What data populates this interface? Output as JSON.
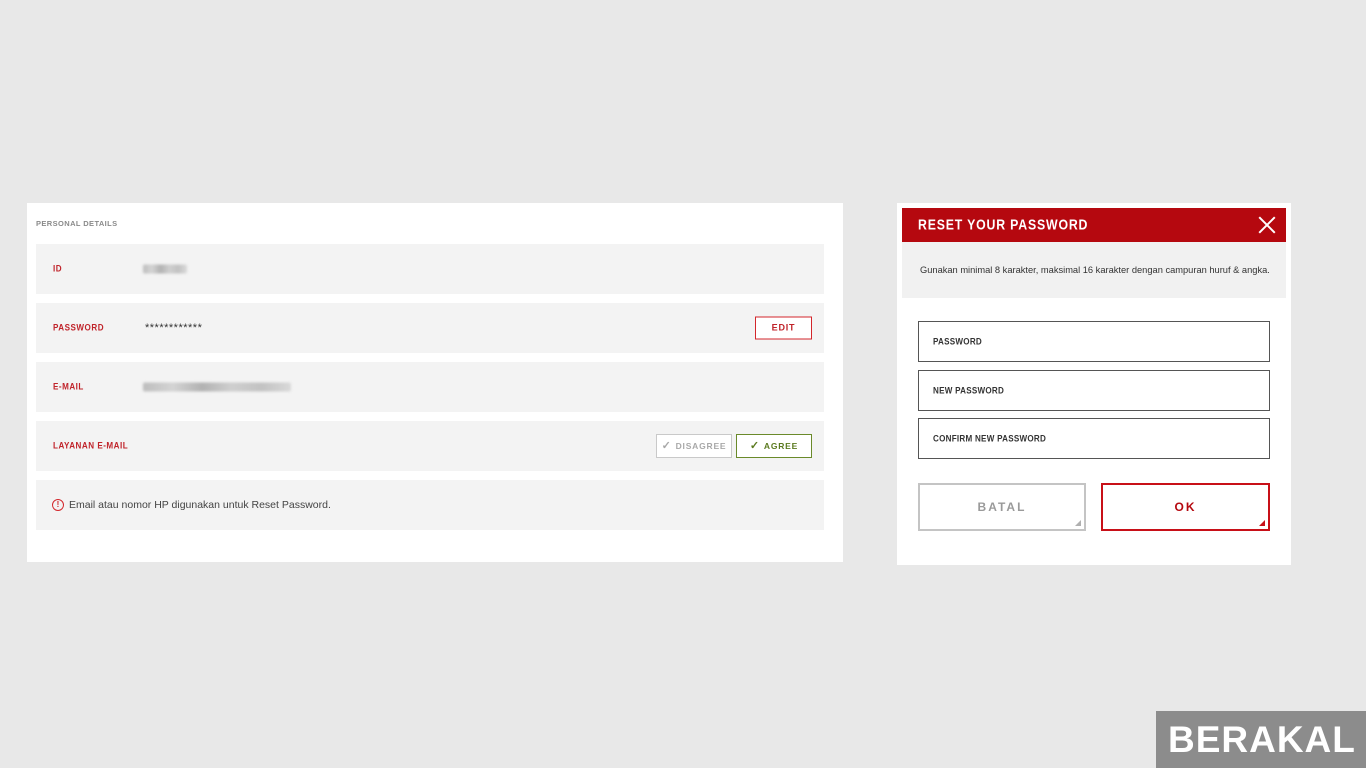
{
  "personal_details": {
    "section_title": "PERSONAL DETAILS",
    "rows": [
      {
        "label": "ID",
        "value": ""
      },
      {
        "label": "PASSWORD",
        "value": "************",
        "action": "EDIT"
      },
      {
        "label": "E-MAIL",
        "value": ""
      },
      {
        "label": "LAYANAN E-MAIL",
        "disagree": "DISAGREE",
        "agree": "AGREE"
      }
    ],
    "info": "Email atau nomor HP digunakan untuk Reset Password."
  },
  "reset_dialog": {
    "title": "RESET YOUR PASSWORD",
    "note": "Gunakan minimal 8 karakter, maksimal 16 karakter dengan campuran huruf & angka.",
    "fields": [
      "PASSWORD",
      "NEW PASSWORD",
      "CONFIRM NEW PASSWORD"
    ],
    "cancel_label": "BATAL",
    "ok_label": "OK"
  },
  "watermark": "BERAKAL",
  "colors": {
    "accent": "#b5080f",
    "agree": "#5b7a1f",
    "background": "#e8e8e8"
  }
}
